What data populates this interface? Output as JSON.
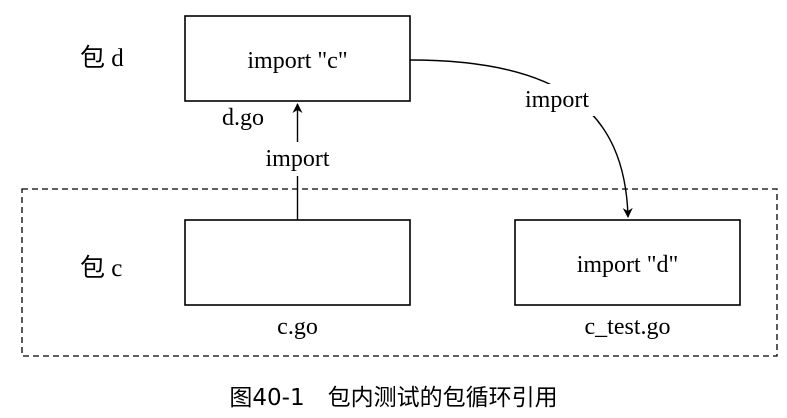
{
  "package_d": {
    "label": "包 d",
    "file": "d.go",
    "code": "import \"c\""
  },
  "package_c": {
    "label": "包 c",
    "files": [
      {
        "name": "c.go",
        "code": ""
      },
      {
        "name": "c_test.go",
        "code": "import \"d\""
      }
    ]
  },
  "edges": [
    {
      "from": "c.go",
      "to": "d.go",
      "label": "import"
    },
    {
      "from": "d.go",
      "to": "c_test.go",
      "label": "import"
    }
  ],
  "caption": "图40-1　包内测试的包循环引用",
  "colors": {
    "stroke": "#000000",
    "background": "#ffffff"
  }
}
